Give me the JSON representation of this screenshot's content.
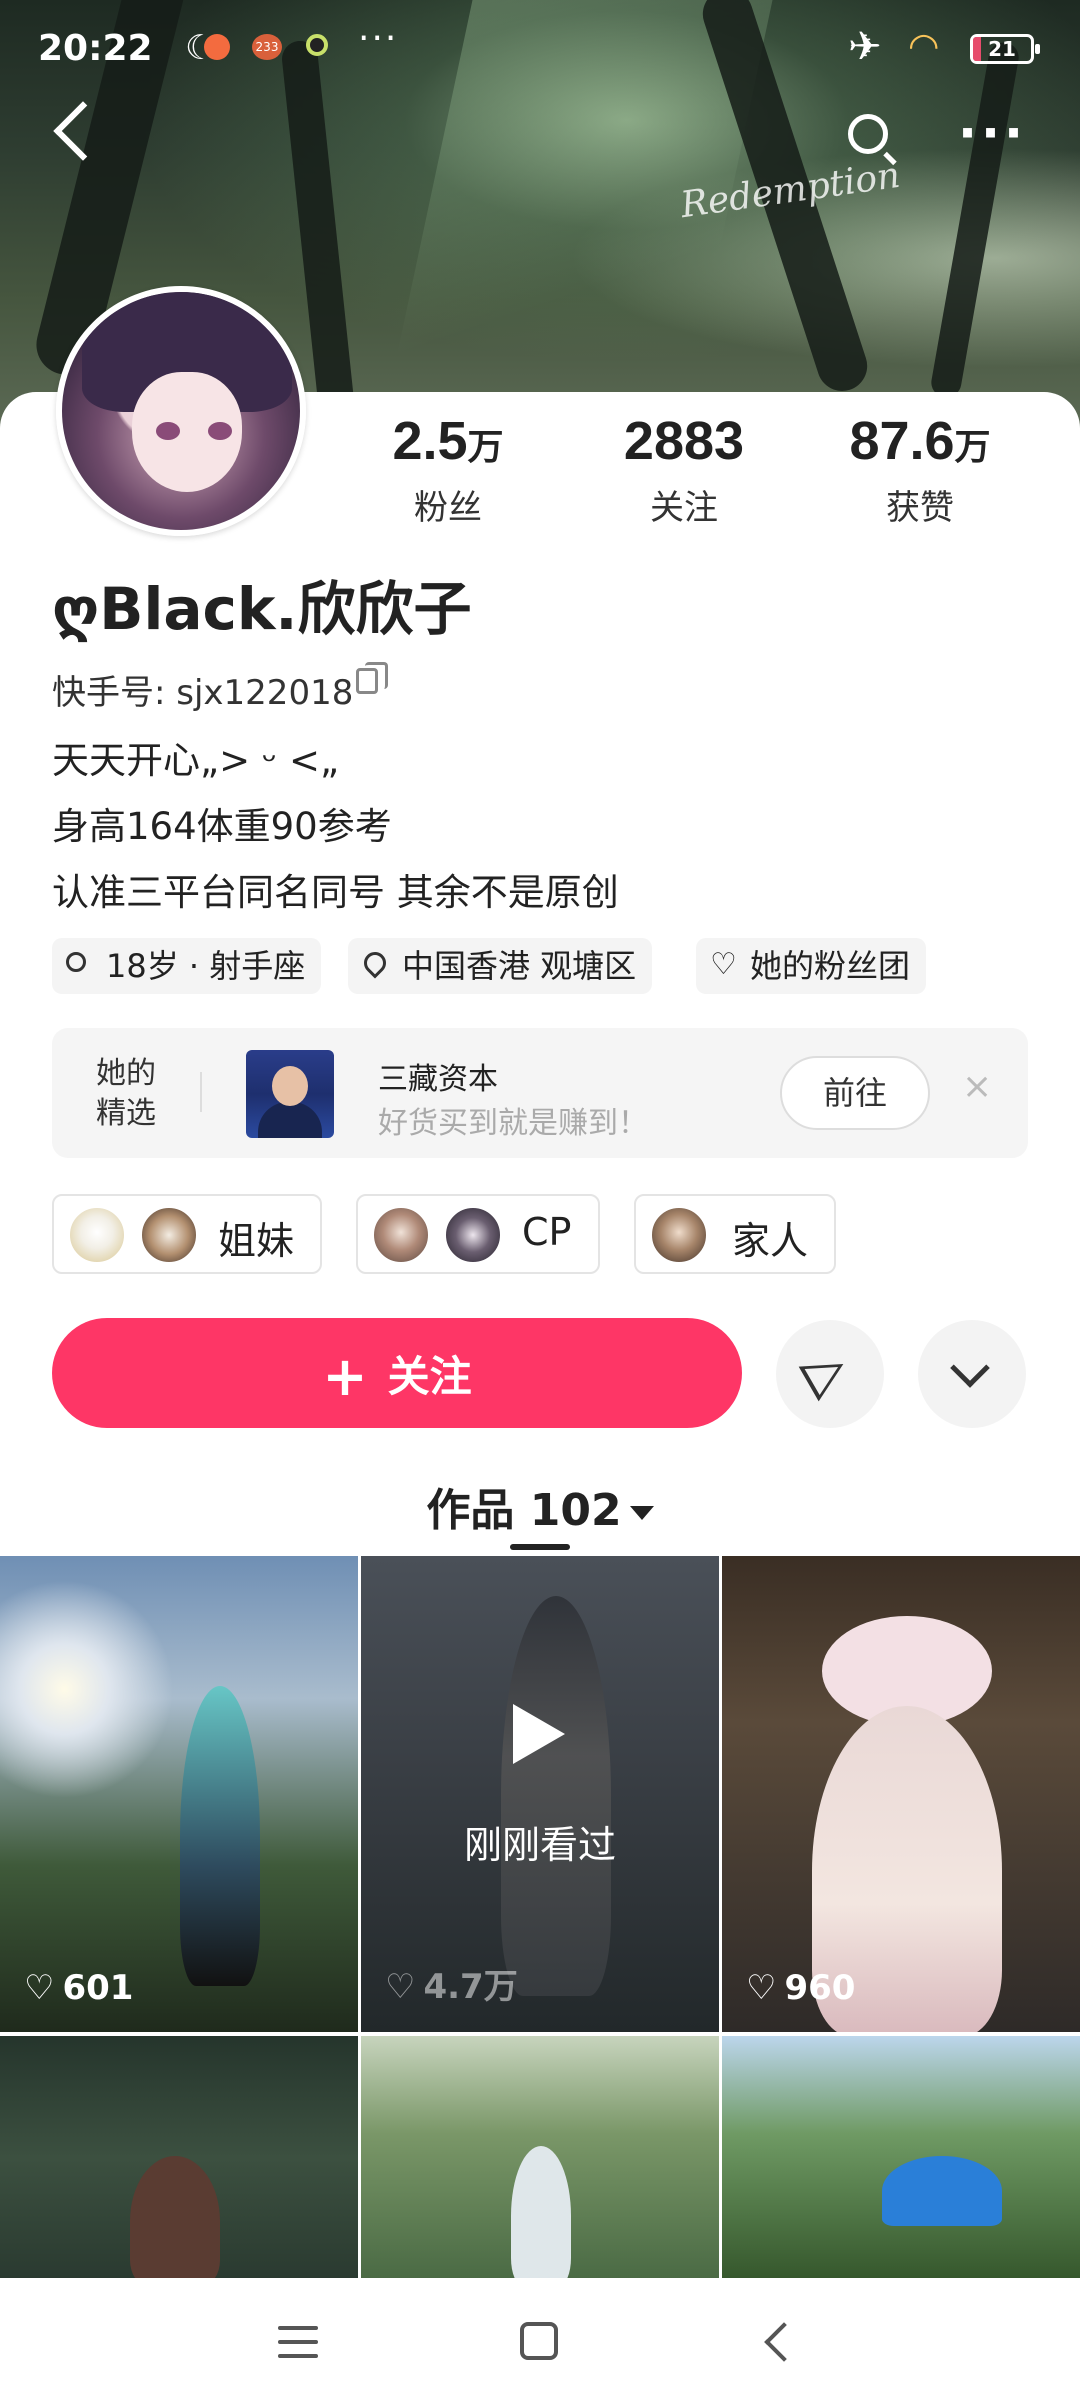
{
  "status_bar": {
    "time": "20:22",
    "badge_number": "233",
    "battery": "21"
  },
  "header": {
    "banner_signature": "Redemption"
  },
  "profile": {
    "name": "ღBlack.欣欣子",
    "kuaishou_id": "快手号: sjx122018",
    "bio": [
      "天天开心„> ᵕ <„",
      "身高164体重90参考",
      "认准三平台同名同号 其余不是原创"
    ],
    "stats": [
      {
        "num": "2.5",
        "unit": "万",
        "label": "粉丝"
      },
      {
        "num": "2883",
        "unit": "",
        "label": "关注"
      },
      {
        "num": "87.6",
        "unit": "万",
        "label": "获赞"
      }
    ],
    "tags": [
      "18岁 · 射手座",
      "中国香港 观塘区",
      "她的粉丝团"
    ]
  },
  "selection": {
    "label_line1": "她的",
    "label_line2": "精选",
    "title": "三藏资本",
    "subtitle": "好货买到就是赚到！",
    "button": "前往",
    "close": "×"
  },
  "groups": [
    "姐妹",
    "CP",
    "家人"
  ],
  "actions": {
    "follow_plus": "+",
    "follow_label": "关注"
  },
  "works": {
    "label": "作品 102",
    "items": [
      {
        "likes": "601"
      },
      {
        "likes": "4.7万",
        "overlay": "刚刚看过"
      },
      {
        "likes": "960"
      }
    ]
  },
  "colors": {
    "accent": "#fe3666"
  }
}
